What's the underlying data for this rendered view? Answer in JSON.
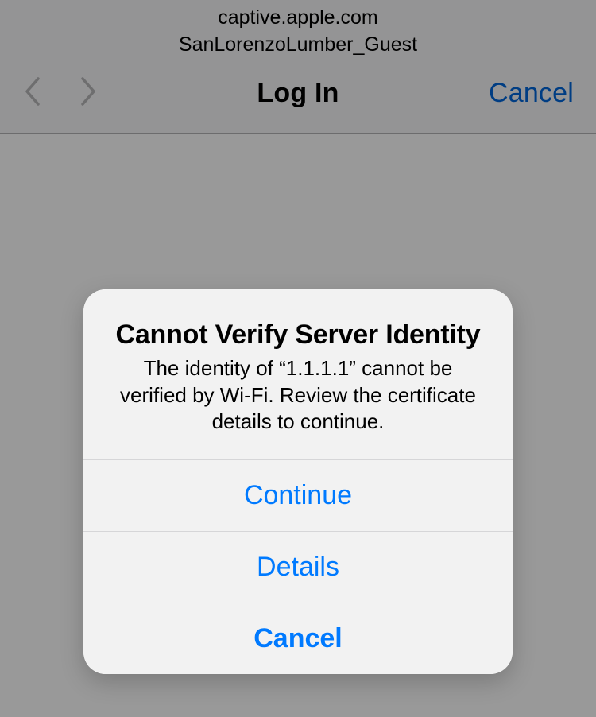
{
  "header": {
    "url": "captive.apple.com",
    "network": "SanLorenzoLumber_Guest",
    "title": "Log In",
    "cancel_label": "Cancel"
  },
  "alert": {
    "title": "Cannot Verify Server Identity",
    "message": "The identity of “1.1.1.1” cannot be verified by Wi-Fi. Review the certificate details to continue.",
    "continue_label": "Continue",
    "details_label": "Details",
    "cancel_label": "Cancel"
  }
}
